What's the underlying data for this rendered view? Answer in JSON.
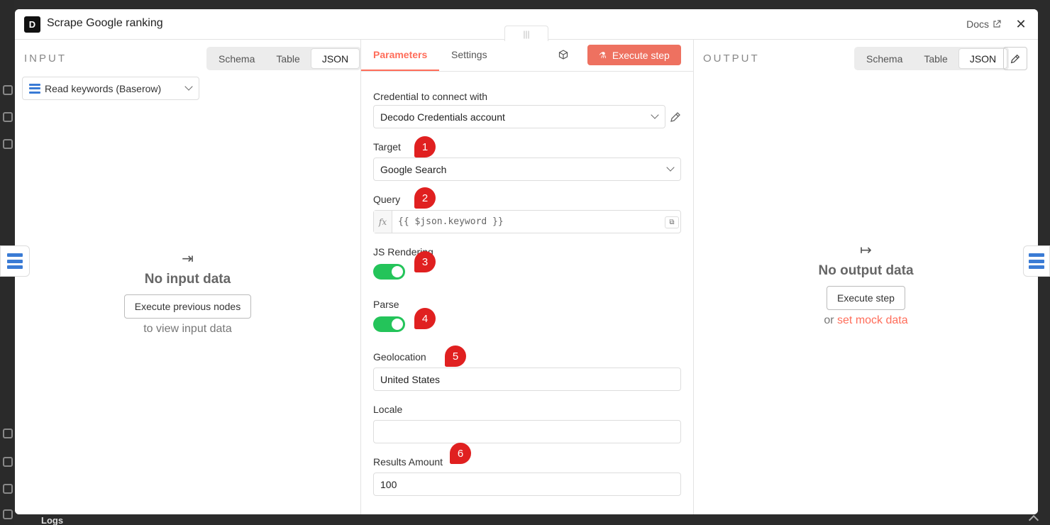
{
  "modal": {
    "title": "Scrape Google ranking",
    "logo_glyph": "D",
    "docs_label": "Docs",
    "drag_handle": "|||"
  },
  "input_panel": {
    "label": "INPUT",
    "views": [
      "Schema",
      "Table",
      "JSON"
    ],
    "active_view": "JSON",
    "source_node": "Read keywords (Baserow)",
    "empty_title": "No input data",
    "execute_button": "Execute previous nodes",
    "empty_sub": "to view input data"
  },
  "params_panel": {
    "tabs": [
      "Parameters",
      "Settings"
    ],
    "active_tab": "Parameters",
    "execute_button": "Execute step",
    "credential_label": "Credential to connect with",
    "credential_value": "Decodo Credentials account",
    "target_label": "Target",
    "target_value": "Google Search",
    "query_label": "Query",
    "query_fx": "fx",
    "query_value": "{{ $json.keyword }}",
    "js_rendering_label": "JS Rendering",
    "js_rendering_on": true,
    "parse_label": "Parse",
    "parse_on": true,
    "geolocation_label": "Geolocation",
    "geolocation_value": "United States",
    "locale_label": "Locale",
    "locale_value": "",
    "results_label": "Results Amount",
    "results_value": "100"
  },
  "output_panel": {
    "label": "OUTPUT",
    "views": [
      "Schema",
      "Table",
      "JSON"
    ],
    "active_view": "JSON",
    "empty_title": "No output data",
    "execute_button": "Execute step",
    "or_text": "or",
    "mock_link": "set mock data"
  },
  "markers": [
    "1",
    "2",
    "3",
    "4",
    "5",
    "6"
  ],
  "background": {
    "logs_label": "Logs"
  },
  "colors": {
    "accent": "#ff6d5a",
    "execute_bg": "#ee7160",
    "toggle_on": "#24c45a",
    "marker": "#e02020",
    "baserow_blue": "#3a7bd5"
  }
}
